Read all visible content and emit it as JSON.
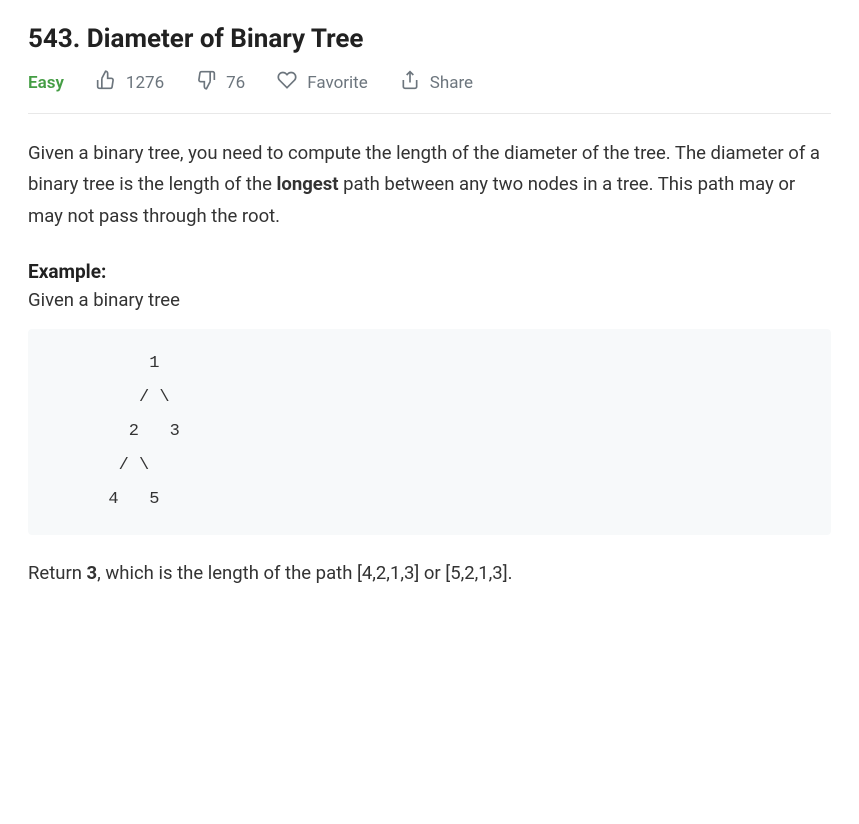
{
  "title": "543. Diameter of Binary Tree",
  "difficulty": "Easy",
  "meta": {
    "likes": "1276",
    "dislikes": "76",
    "favorite_label": "Favorite",
    "share_label": "Share"
  },
  "description": {
    "part1": "Given a binary tree, you need to compute the length of the diameter of the tree. The diameter of a binary tree is the length of the ",
    "bold": "longest",
    "part2": " path between any two nodes in a tree. This path may or may not pass through the root."
  },
  "example_label": "Example:",
  "example_intro": "Given a binary tree",
  "tree_ascii": "      1\n     / \\\n    2   3\n   / \\\n  4   5",
  "result": {
    "part1": "Return ",
    "bold": "3",
    "part2": ", which is the length of the path [4,2,1,3] or [5,2,1,3]."
  }
}
